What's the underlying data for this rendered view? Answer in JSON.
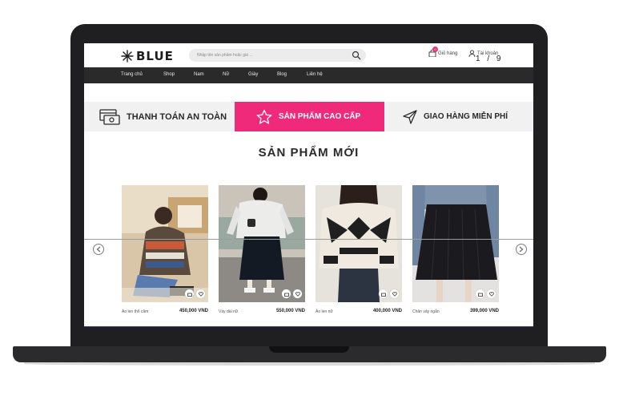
{
  "brand": {
    "logo_text": "BLUE"
  },
  "search": {
    "placeholder": "Nhập tên sản phẩm hoặc giá ..."
  },
  "header": {
    "cart_label": "Giỏ hàng",
    "cart_count": "0",
    "account_label": "Tài khoản"
  },
  "nav": {
    "items": [
      "Trang chủ",
      "Shop",
      "Nam",
      "Nữ",
      "Giày",
      "Blog",
      "Liên hệ"
    ]
  },
  "slider": {
    "indicator": "1 / 9"
  },
  "features": {
    "pay": "THANH TOÁN AN TOÀN",
    "premium": "SẢN PHẨM CAO CẤP",
    "ship": "GIAO HÀNG MIỄN PHÍ"
  },
  "section": {
    "title": "SẢN PHẨM MỚI"
  },
  "products": [
    {
      "name": "Áo len thổ cẩm",
      "price": "450,000 VND"
    },
    {
      "name": "Váy dài nữ",
      "price": "550,000 VND"
    },
    {
      "name": "Áo len nữ",
      "price": "400,000 VND"
    },
    {
      "name": "Chân váy ngắn",
      "price": "399,000 VND"
    }
  ],
  "colors": {
    "accent": "#ef2a7b",
    "nav_bg": "#2a2a2a",
    "frame": "#1f1f22"
  },
  "icons": [
    "logo-star-icon",
    "search-icon",
    "bag-icon",
    "user-icon",
    "card-icon",
    "star-icon",
    "send-icon",
    "chevron-left-icon",
    "chevron-right-icon",
    "heart-icon"
  ]
}
